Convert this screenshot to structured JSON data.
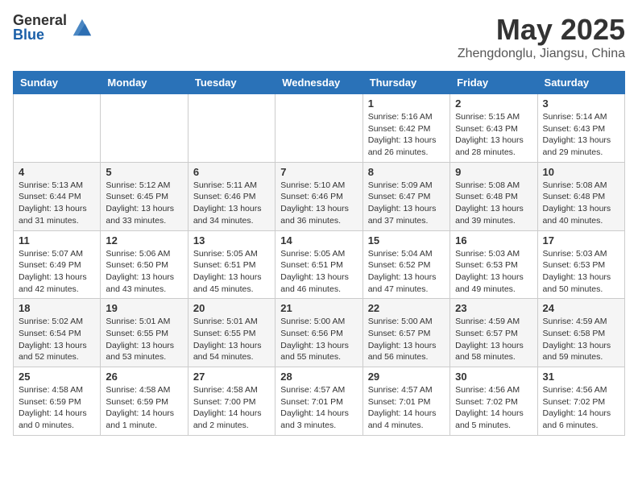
{
  "header": {
    "logo_general": "General",
    "logo_blue": "Blue",
    "month_title": "May 2025",
    "subtitle": "Zhengdonglu, Jiangsu, China"
  },
  "weekdays": [
    "Sunday",
    "Monday",
    "Tuesday",
    "Wednesday",
    "Thursday",
    "Friday",
    "Saturday"
  ],
  "weeks": [
    [
      {
        "day": "",
        "info": ""
      },
      {
        "day": "",
        "info": ""
      },
      {
        "day": "",
        "info": ""
      },
      {
        "day": "",
        "info": ""
      },
      {
        "day": "1",
        "info": "Sunrise: 5:16 AM\nSunset: 6:42 PM\nDaylight: 13 hours\nand 26 minutes."
      },
      {
        "day": "2",
        "info": "Sunrise: 5:15 AM\nSunset: 6:43 PM\nDaylight: 13 hours\nand 28 minutes."
      },
      {
        "day": "3",
        "info": "Sunrise: 5:14 AM\nSunset: 6:43 PM\nDaylight: 13 hours\nand 29 minutes."
      }
    ],
    [
      {
        "day": "4",
        "info": "Sunrise: 5:13 AM\nSunset: 6:44 PM\nDaylight: 13 hours\nand 31 minutes."
      },
      {
        "day": "5",
        "info": "Sunrise: 5:12 AM\nSunset: 6:45 PM\nDaylight: 13 hours\nand 33 minutes."
      },
      {
        "day": "6",
        "info": "Sunrise: 5:11 AM\nSunset: 6:46 PM\nDaylight: 13 hours\nand 34 minutes."
      },
      {
        "day": "7",
        "info": "Sunrise: 5:10 AM\nSunset: 6:46 PM\nDaylight: 13 hours\nand 36 minutes."
      },
      {
        "day": "8",
        "info": "Sunrise: 5:09 AM\nSunset: 6:47 PM\nDaylight: 13 hours\nand 37 minutes."
      },
      {
        "day": "9",
        "info": "Sunrise: 5:08 AM\nSunset: 6:48 PM\nDaylight: 13 hours\nand 39 minutes."
      },
      {
        "day": "10",
        "info": "Sunrise: 5:08 AM\nSunset: 6:48 PM\nDaylight: 13 hours\nand 40 minutes."
      }
    ],
    [
      {
        "day": "11",
        "info": "Sunrise: 5:07 AM\nSunset: 6:49 PM\nDaylight: 13 hours\nand 42 minutes."
      },
      {
        "day": "12",
        "info": "Sunrise: 5:06 AM\nSunset: 6:50 PM\nDaylight: 13 hours\nand 43 minutes."
      },
      {
        "day": "13",
        "info": "Sunrise: 5:05 AM\nSunset: 6:51 PM\nDaylight: 13 hours\nand 45 minutes."
      },
      {
        "day": "14",
        "info": "Sunrise: 5:05 AM\nSunset: 6:51 PM\nDaylight: 13 hours\nand 46 minutes."
      },
      {
        "day": "15",
        "info": "Sunrise: 5:04 AM\nSunset: 6:52 PM\nDaylight: 13 hours\nand 47 minutes."
      },
      {
        "day": "16",
        "info": "Sunrise: 5:03 AM\nSunset: 6:53 PM\nDaylight: 13 hours\nand 49 minutes."
      },
      {
        "day": "17",
        "info": "Sunrise: 5:03 AM\nSunset: 6:53 PM\nDaylight: 13 hours\nand 50 minutes."
      }
    ],
    [
      {
        "day": "18",
        "info": "Sunrise: 5:02 AM\nSunset: 6:54 PM\nDaylight: 13 hours\nand 52 minutes."
      },
      {
        "day": "19",
        "info": "Sunrise: 5:01 AM\nSunset: 6:55 PM\nDaylight: 13 hours\nand 53 minutes."
      },
      {
        "day": "20",
        "info": "Sunrise: 5:01 AM\nSunset: 6:55 PM\nDaylight: 13 hours\nand 54 minutes."
      },
      {
        "day": "21",
        "info": "Sunrise: 5:00 AM\nSunset: 6:56 PM\nDaylight: 13 hours\nand 55 minutes."
      },
      {
        "day": "22",
        "info": "Sunrise: 5:00 AM\nSunset: 6:57 PM\nDaylight: 13 hours\nand 56 minutes."
      },
      {
        "day": "23",
        "info": "Sunrise: 4:59 AM\nSunset: 6:57 PM\nDaylight: 13 hours\nand 58 minutes."
      },
      {
        "day": "24",
        "info": "Sunrise: 4:59 AM\nSunset: 6:58 PM\nDaylight: 13 hours\nand 59 minutes."
      }
    ],
    [
      {
        "day": "25",
        "info": "Sunrise: 4:58 AM\nSunset: 6:59 PM\nDaylight: 14 hours\nand 0 minutes."
      },
      {
        "day": "26",
        "info": "Sunrise: 4:58 AM\nSunset: 6:59 PM\nDaylight: 14 hours\nand 1 minute."
      },
      {
        "day": "27",
        "info": "Sunrise: 4:58 AM\nSunset: 7:00 PM\nDaylight: 14 hours\nand 2 minutes."
      },
      {
        "day": "28",
        "info": "Sunrise: 4:57 AM\nSunset: 7:01 PM\nDaylight: 14 hours\nand 3 minutes."
      },
      {
        "day": "29",
        "info": "Sunrise: 4:57 AM\nSunset: 7:01 PM\nDaylight: 14 hours\nand 4 minutes."
      },
      {
        "day": "30",
        "info": "Sunrise: 4:56 AM\nSunset: 7:02 PM\nDaylight: 14 hours\nand 5 minutes."
      },
      {
        "day": "31",
        "info": "Sunrise: 4:56 AM\nSunset: 7:02 PM\nDaylight: 14 hours\nand 6 minutes."
      }
    ]
  ]
}
